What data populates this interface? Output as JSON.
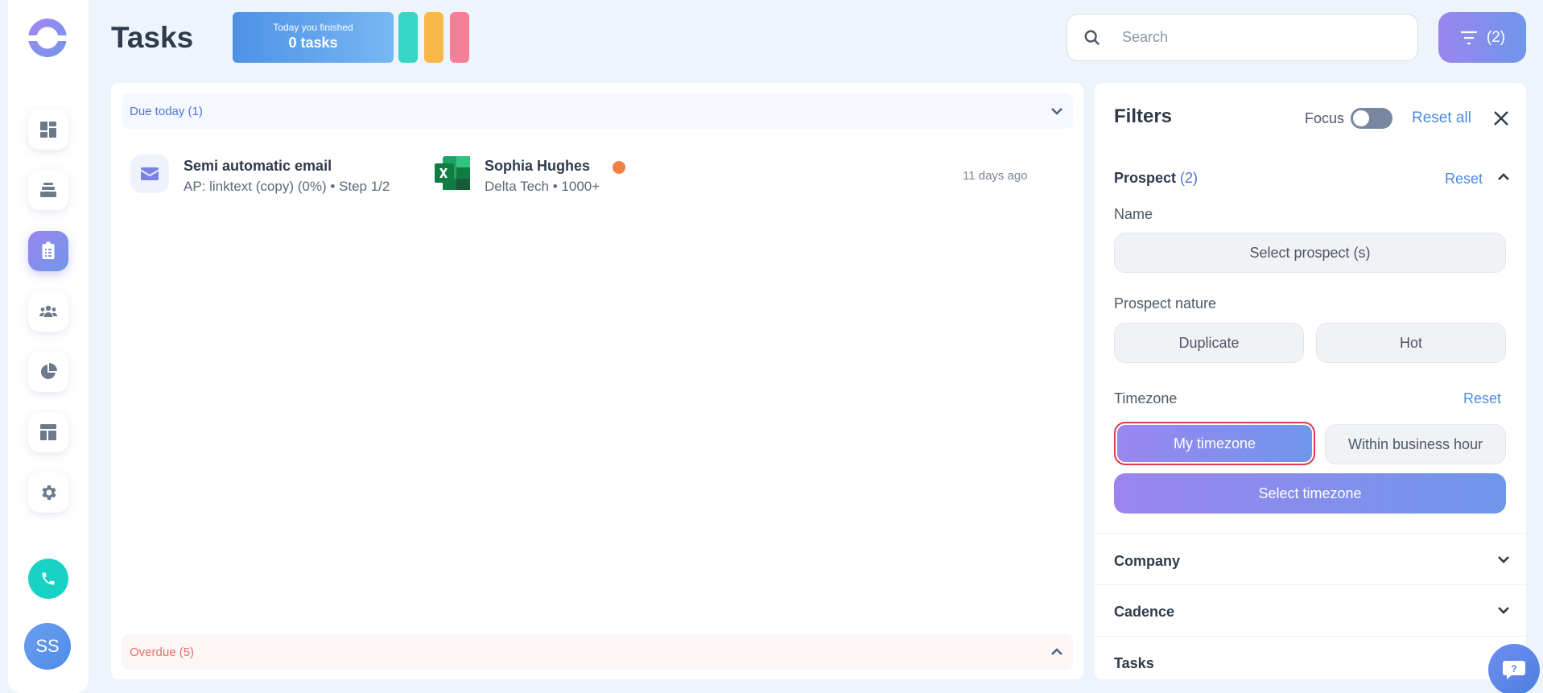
{
  "header": {
    "title": "Tasks",
    "finished_line1": "Today you finished",
    "finished_line2": "0 tasks",
    "mini_bar_colors": [
      "#35d6c6",
      "#f9b84a",
      "#f57f97"
    ],
    "search_placeholder": "Search",
    "filter_count": "(2)"
  },
  "sidebar": {
    "items": [
      {
        "name": "dashboard",
        "icon": "dashboard-icon"
      },
      {
        "name": "cadences",
        "icon": "stack-icon"
      },
      {
        "name": "tasks",
        "icon": "clipboard-icon",
        "active": true
      },
      {
        "name": "contacts",
        "icon": "people-icon"
      },
      {
        "name": "analytics",
        "icon": "pie-chart-icon"
      },
      {
        "name": "templates",
        "icon": "layout-icon"
      },
      {
        "name": "settings",
        "icon": "gear-icon"
      }
    ],
    "avatar_initials": "SS"
  },
  "tasks": {
    "due_today_label": "Due today (1)",
    "overdue_label": "Overdue (5)",
    "rows": [
      {
        "type_icon": "email-icon",
        "name": "Semi automatic email",
        "subtitle": "AP: linktext (copy) (0%) • Step 1/2",
        "source_icon": "excel-icon",
        "contact_name": "Sophia Hughes",
        "contact_sub": "Delta Tech • 1000+",
        "time": "11 days ago"
      }
    ]
  },
  "filters": {
    "title": "Filters",
    "focus_label": "Focus",
    "focus_on": false,
    "reset_all": "Reset all",
    "prospect_title": "Prospect",
    "prospect_count": "(2)",
    "reset_label": "Reset",
    "name_label": "Name",
    "select_prospect": "Select prospect (s)",
    "nature_label": "Prospect nature",
    "nature_options": [
      "Duplicate",
      "Hot"
    ],
    "timezone_label": "Timezone",
    "timezone_options": [
      "My timezone",
      "Within business hour"
    ],
    "timezone_selected": "My timezone",
    "select_timezone": "Select timezone",
    "company_title": "Company",
    "cadence_title": "Cadence",
    "tasks_title": "Tasks"
  },
  "colors": {
    "accent_gradient_start": "#9b85ef",
    "accent_gradient_end": "#6f97ea",
    "link_blue": "#4c8ae3",
    "overdue_red": "#ec6c6c",
    "phone_teal": "#18d3c5"
  }
}
